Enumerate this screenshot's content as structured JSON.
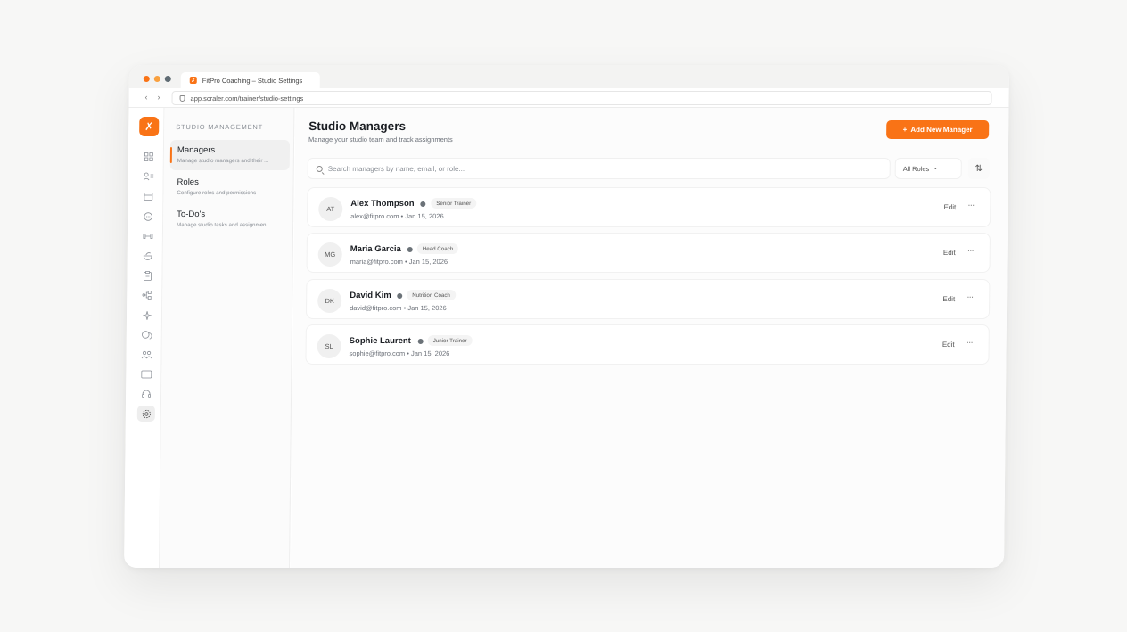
{
  "colors": {
    "accent": "#f97316",
    "dot_close": "#f97316",
    "dot_min": "#f9a03f",
    "dot_max": "#5f6b73",
    "status": "#6b7278"
  },
  "browser": {
    "tab_title": "FitPro Coaching – Studio Settings",
    "tab_icon": "fitpro-logo-icon",
    "url": "app.scraler.com/trainer/studio-settings",
    "back_glyph": "‹",
    "forward_glyph": "›"
  },
  "rail": {
    "logo_glyph": "✗",
    "icons": [
      "dashboard-icon",
      "clients-icon",
      "calendar-icon",
      "messages-icon",
      "workouts-icon",
      "nutrition-icon",
      "programs-icon",
      "automations-icon",
      "ai-sparkle-icon",
      "community-icon",
      "team-icon",
      "billing-icon",
      "support-icon",
      "settings-icon"
    ]
  },
  "subnav": {
    "section_title": "STUDIO MANAGEMENT",
    "items": [
      {
        "title": "Managers",
        "desc": "Manage studio managers and their ..."
      },
      {
        "title": "Roles",
        "desc": "Configure roles and permissions"
      },
      {
        "title": "To-Do's",
        "desc": "Manage studio tasks and assignmen..."
      }
    ]
  },
  "header": {
    "title": "Studio Managers",
    "subtitle": "Manage your studio team and track assignments",
    "add_button_icon": "+",
    "add_button_label": "Add New Manager"
  },
  "filters": {
    "search_placeholder": "Search managers by name, email, or role...",
    "roles_value": "All Roles",
    "roles_chevron": "⌄",
    "sort_glyph": "⇅"
  },
  "managers": [
    {
      "initials": "AT",
      "name": "Alex Thompson",
      "role": "Senior Trainer",
      "meta": "alex@fitpro.com • Jan 15, 2026",
      "edit": "Edit",
      "more": "···"
    },
    {
      "initials": "MG",
      "name": "Maria Garcia",
      "role": "Head Coach",
      "meta": "maria@fitpro.com • Jan 15, 2026",
      "edit": "Edit",
      "more": "···"
    },
    {
      "initials": "DK",
      "name": "David Kim",
      "role": "Nutrition Coach",
      "meta": "david@fitpro.com • Jan 15, 2026",
      "edit": "Edit",
      "more": "···"
    },
    {
      "initials": "SL",
      "name": "Sophie Laurent",
      "role": "Junior Trainer",
      "meta": "sophie@fitpro.com • Jan 15, 2026",
      "edit": "Edit",
      "more": "···"
    }
  ]
}
